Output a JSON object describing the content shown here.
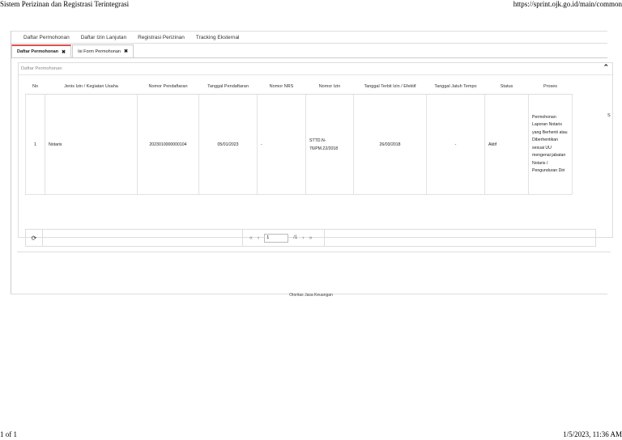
{
  "print_header": {
    "title": "Sistem Perizinan dan Registrasi Terintegrasi",
    "url": "https://sprint.ojk.go.id/main/common"
  },
  "print_footer": {
    "page": "1 of 1",
    "datetime": "1/5/2023, 11:36 AM"
  },
  "topnav": {
    "items": [
      "Daftar Permohonan",
      "Daftar Izin Lanjutan",
      "Registrasi Perizinan",
      "Tracking Eksternal"
    ]
  },
  "tabs": [
    {
      "label": "Daftar Permohonan",
      "close": "✖"
    },
    {
      "label": "Isi Form Permohonan",
      "close": "✖"
    }
  ],
  "panel": {
    "title": "Daftar Permohonan",
    "collapse_icon": "chevron-up-icon"
  },
  "table": {
    "headers": [
      "No",
      "Jenis Izin / Kegiatan Usaha",
      "Nomor Pendaftaran",
      "Tanggal Pendaftaran",
      "Nomor NRS",
      "Nomor Izin",
      "Tanggal Terbit Izin / Efektif",
      "Tanggal Jatuh Tempo",
      "Status",
      "Proses"
    ],
    "truncated_header": "S",
    "rows": [
      {
        "no": "1",
        "jenis": "Notaris",
        "nomor_pendaftaran": "2023010000000104",
        "tanggal_pendaftaran": "05/01/2023",
        "nomor_nrs": "-",
        "nomor_izin": "STTD.N-76/PM.22/2018",
        "tanggal_terbit": "26/03/2018",
        "tanggal_jatuh_tempo": "-",
        "status": "Aktif",
        "proses": "Permohonan Laporan Notaris yang Berhenti atau Diberhentikan sesuai UU mengenai jabatan Notaris / Pengunduran Diri"
      }
    ]
  },
  "pager": {
    "first": "«",
    "prev": "‹",
    "page_value": "1",
    "of_label": "/1",
    "next": "›",
    "last": "»"
  },
  "footer": {
    "text": "Otoritas Jasa Keuangan"
  }
}
